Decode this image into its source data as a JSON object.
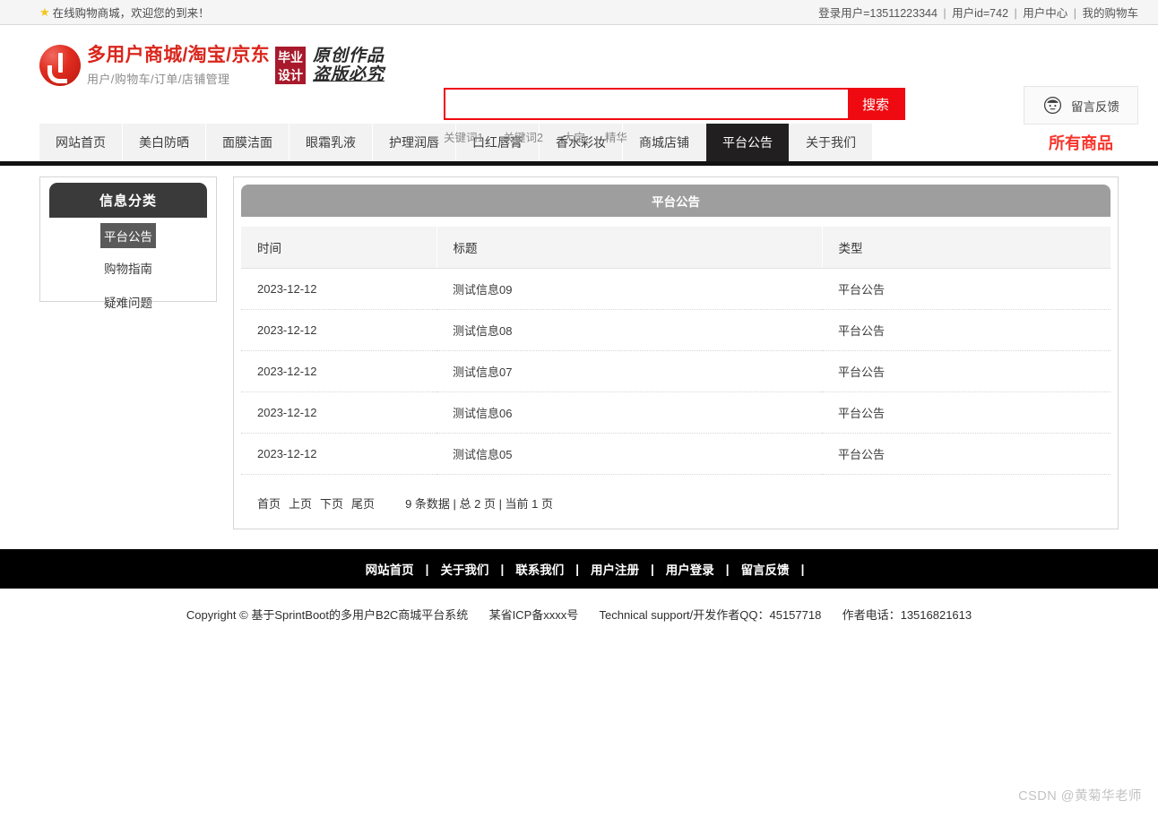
{
  "topbar": {
    "star_icon": "star-icon",
    "welcome": "在线购物商城，欢迎您的到来！",
    "login_user": "登录用户=13511223344",
    "user_id": "用户id=742",
    "user_center": "用户中心",
    "my_cart": "我的购物车",
    "sep": "|"
  },
  "header": {
    "logo_icon": "brand-logo-icon",
    "brand_title": "多用户商城/淘宝/京东",
    "brand_sub": "用户/购物车/订单/店铺管理",
    "badge_line1": "毕业",
    "badge_line2": "设计",
    "original_line1": "原创作品",
    "original_line2": "盗版必究",
    "search": {
      "value": "",
      "placeholder": "",
      "button": "搜索",
      "hot_words": [
        "关键词1",
        "关键词2",
        "大宝",
        "精华"
      ]
    },
    "feedback": {
      "icon": "face-icon",
      "label": "留言反馈"
    }
  },
  "nav": {
    "items": [
      {
        "label": "网站首页",
        "active": false
      },
      {
        "label": "美白防晒",
        "active": false
      },
      {
        "label": "面膜洁面",
        "active": false
      },
      {
        "label": "眼霜乳液",
        "active": false
      },
      {
        "label": "护理润唇",
        "active": false
      },
      {
        "label": "口红唇膏",
        "active": false
      },
      {
        "label": "香水彩妆",
        "active": false
      },
      {
        "label": "商城店铺",
        "active": false
      },
      {
        "label": "平台公告",
        "active": true
      },
      {
        "label": "关于我们",
        "active": false
      }
    ],
    "all_products": "所有商品",
    "accent_color": "#f5352c"
  },
  "sidebar": {
    "title": "信息分类",
    "items": [
      {
        "label": "平台公告",
        "active": true
      },
      {
        "label": "购物指南",
        "active": false
      },
      {
        "label": "疑难问题",
        "active": false
      }
    ]
  },
  "panel": {
    "title": "平台公告",
    "columns": [
      "时间",
      "标题",
      "类型"
    ],
    "rows": [
      {
        "time": "2023-12-12",
        "title": "测试信息09",
        "type": "平台公告"
      },
      {
        "time": "2023-12-12",
        "title": "测试信息08",
        "type": "平台公告"
      },
      {
        "time": "2023-12-12",
        "title": "测试信息07",
        "type": "平台公告"
      },
      {
        "time": "2023-12-12",
        "title": "测试信息06",
        "type": "平台公告"
      },
      {
        "time": "2023-12-12",
        "title": "测试信息05",
        "type": "平台公告"
      }
    ],
    "pager": {
      "first": "首页",
      "prev": "上页",
      "next": "下页",
      "last": "尾页",
      "info": "9 条数据 | 总 2 页 | 当前 1 页"
    }
  },
  "footer": {
    "links": [
      "网站首页",
      "关于我们",
      "联系我们",
      "用户注册",
      "用户登录",
      "留言反馈"
    ],
    "separator": "|",
    "copyright": "Copyright © 基于SprintBoot的多用户B2C商城平台系统",
    "icp": "某省ICP备xxxx号",
    "support": "Technical support/开发作者QQ：45157718",
    "phone": "作者电话：13516821613"
  },
  "watermark": "CSDN @黄菊华老师"
}
